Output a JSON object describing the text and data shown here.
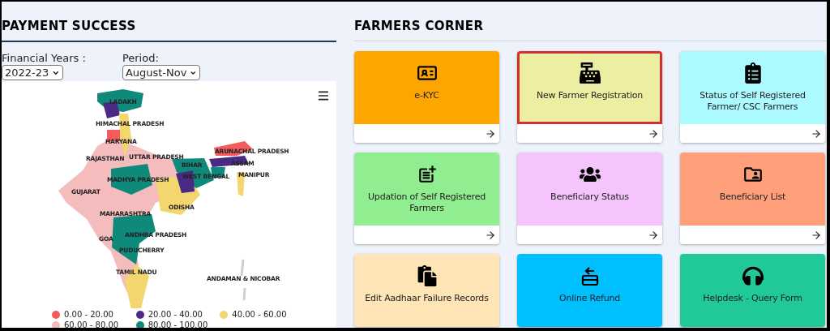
{
  "payment_success": {
    "title": "PAYMENT SUCCESS",
    "financial_year": {
      "label": "Financial Years :",
      "value": "2022-23"
    },
    "period": {
      "label": "Period:",
      "value": "August-Nov"
    },
    "map_labels": [
      "LADAKH",
      "HIMACHAL PRADESH",
      "HARYANA",
      "ARUNACHAL PRADESH",
      "RAJASTHAN",
      "UTTAR PRADESH",
      "BIHAR",
      "ASSAM",
      "WEST BENGAL",
      "MANIPUR",
      "MADHYA PRADESH",
      "GUJARAT",
      "ODISHA",
      "MAHARASHTRA",
      "GOA",
      "ANDHRA PRADESH",
      "PUDUCHERRY",
      "TAMIL NADU",
      "ANDAMAN & NICOBAR"
    ],
    "legend": [
      {
        "label": "0.00 - 20.00",
        "color": "#f25c5c"
      },
      {
        "label": "20.00 - 40.00",
        "color": "#4b2a86"
      },
      {
        "label": "40.00 - 60.00",
        "color": "#f3d66e"
      },
      {
        "label": "60.00 - 80.00",
        "color": "#f4bcbc"
      },
      {
        "label": "80.00 - 100.00",
        "color": "#0f8a7a"
      }
    ]
  },
  "farmers_corner": {
    "title": "FARMERS CORNER",
    "cards": [
      {
        "label": "e-KYC",
        "color": "#ffa500",
        "highlighted": false,
        "footer": true
      },
      {
        "label": "New Farmer Registration",
        "color": "#eeeea2",
        "highlighted": true,
        "footer": true
      },
      {
        "label": "Status of Self Registered Farmer/ CSC Farmers",
        "color": "#aafaff",
        "highlighted": false,
        "footer": true
      },
      {
        "label": "Updation of Self Registered Farmers",
        "color": "#90ee90",
        "highlighted": false,
        "footer": true
      },
      {
        "label": "Beneficiary Status",
        "color": "#f5c4fc",
        "highlighted": false,
        "footer": true
      },
      {
        "label": "Beneficiary List",
        "color": "#ffa07a",
        "highlighted": false,
        "footer": true
      },
      {
        "label": "Edit Aadhaar Failure Records",
        "color": "#ffe4b5",
        "highlighted": false,
        "footer": false
      },
      {
        "label": "Online Refund",
        "color": "#00bfff",
        "highlighted": false,
        "footer": false
      },
      {
        "label": "Helpdesk - Query Form",
        "color": "#20c997",
        "highlighted": false,
        "footer": false
      }
    ]
  }
}
